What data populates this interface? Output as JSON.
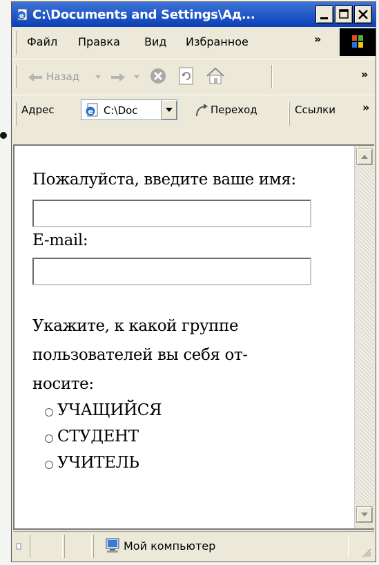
{
  "window": {
    "title": "C:\\Documents and Settings\\Ад...",
    "controls": [
      "minimize-icon",
      "maximize-icon",
      "close-icon"
    ]
  },
  "menu": {
    "items": [
      "Файл",
      "Правка",
      "Вид",
      "Избранное"
    ],
    "overflow": "»"
  },
  "toolbar": {
    "back_label": "Назад",
    "overflow": "»",
    "icons": [
      "back-arrow-icon",
      "forward-arrow-icon",
      "stop-icon",
      "refresh-icon",
      "home-icon"
    ]
  },
  "address": {
    "label": "Адрес",
    "value": "C:\\Doc",
    "go_label": "Переход",
    "links_label": "Ссылки",
    "overflow": "»"
  },
  "form": {
    "name_label": "Пожалуйста, введите ваше имя:",
    "name_value": "",
    "email_label": "E-mail:",
    "email_value": "",
    "group_question": [
      "Укажите, к какой группе",
      "пользователей вы себя от-",
      "носите:"
    ],
    "options": [
      "УЧАЩИЙСЯ",
      "СТУДЕНТ",
      "УЧИТЕЛЬ"
    ]
  },
  "status": {
    "zone": "Мой компьютер"
  },
  "colors": {
    "titlebar": "#0a3fb8",
    "chrome": "#ece9d8"
  }
}
